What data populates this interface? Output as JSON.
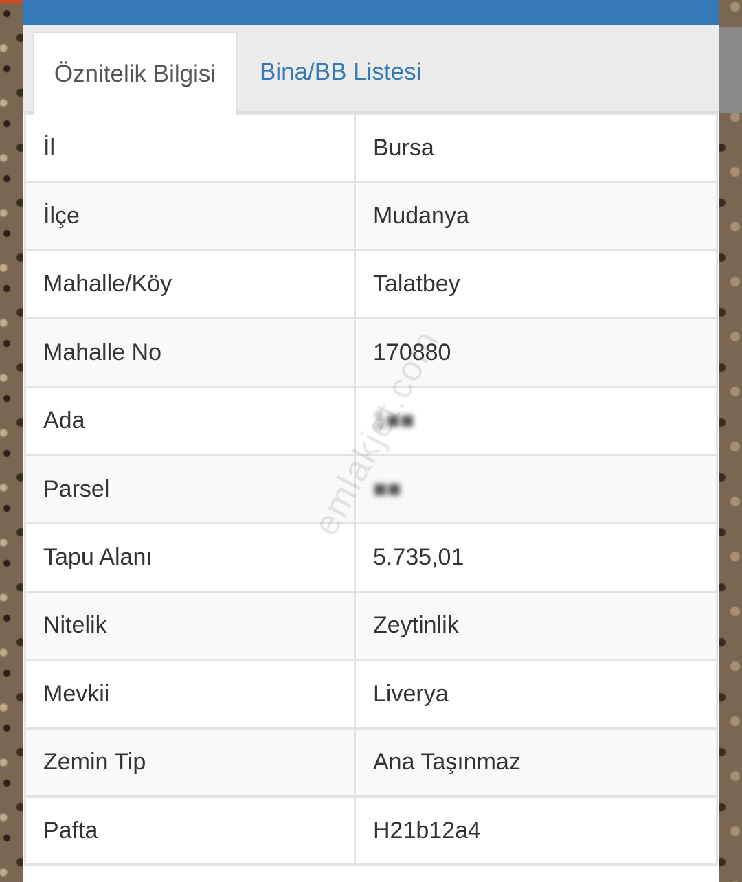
{
  "tabs": [
    {
      "label": "Öznitelik Bilgisi",
      "active": true
    },
    {
      "label": "Bina/BB Listesi",
      "active": false
    }
  ],
  "rows": [
    {
      "key": "İl",
      "value": "Bursa"
    },
    {
      "key": "İlçe",
      "value": "Mudanya"
    },
    {
      "key": "Mahalle/Köy",
      "value": "Talatbey"
    },
    {
      "key": "Mahalle No",
      "value": "170880"
    },
    {
      "key": "Ada",
      "value": "1■■",
      "redacted": true
    },
    {
      "key": "Parsel",
      "value": "■■",
      "redacted": true
    },
    {
      "key": "Tapu Alanı",
      "value": "5.735,01"
    },
    {
      "key": "Nitelik",
      "value": "Zeytinlik"
    },
    {
      "key": "Mevkii",
      "value": "Liverya"
    },
    {
      "key": "Zemin Tip",
      "value": "Ana Taşınmaz"
    },
    {
      "key": "Pafta",
      "value": "H21b12a4"
    }
  ],
  "watermark": "emlakjet.com",
  "colors": {
    "header": "#337ab7",
    "tab_link": "#337ab7",
    "text": "#333333",
    "border": "#e3e3e3"
  }
}
